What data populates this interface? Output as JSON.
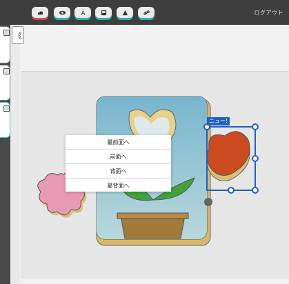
{
  "toolbar": {
    "buttons": [
      {
        "name": "upload-icon"
      },
      {
        "name": "eye-icon"
      },
      {
        "name": "text-icon"
      },
      {
        "name": "image-icon"
      },
      {
        "name": "shape-icon"
      },
      {
        "name": "link-icon"
      }
    ],
    "logout_label": "ログアウト"
  },
  "panel": {
    "collapse_icon": "《"
  },
  "selection": {
    "label": "ニュー!"
  },
  "context_menu": {
    "items": [
      "最前面へ",
      "前面へ",
      "背面へ",
      "最背面へ"
    ]
  },
  "colors": {
    "topbar": "#3e3e3e",
    "button_accent_red": "#d24a5a",
    "button_accent_teal": "#2db3a5",
    "selection_blue": "#1f5fc9"
  }
}
